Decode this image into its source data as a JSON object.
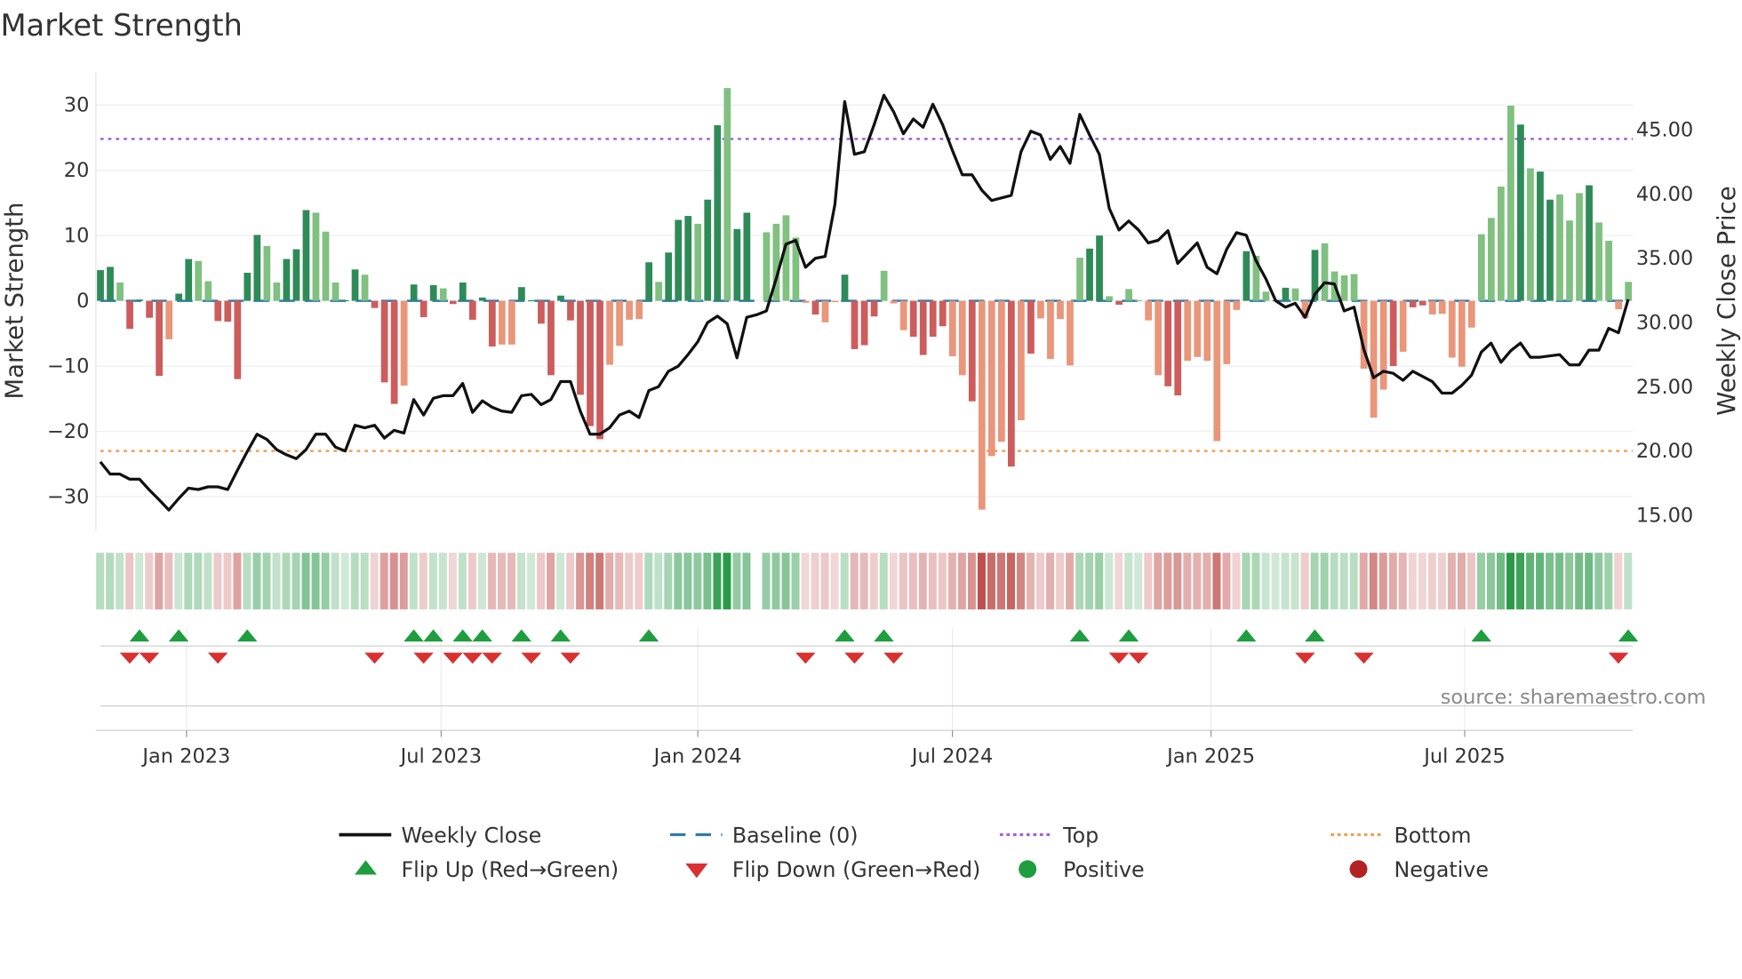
{
  "chart_data": {
    "type": "bar",
    "title": "Market Strength",
    "ylabel": "Market Strength",
    "y2label": "Weekly Close Price",
    "ylim": [
      -33,
      33
    ],
    "y2lim": [
      13.2,
      50.3
    ],
    "yticks": [
      30,
      20,
      10,
      0,
      -10,
      -20,
      -30
    ],
    "yticklabels": [
      "30",
      "20",
      "10",
      "0",
      "−10",
      "−20",
      "−30"
    ],
    "y2ticks": [
      45,
      40,
      35,
      30,
      25,
      20,
      15
    ],
    "y2ticklabels": [
      "45.00",
      "40.00",
      "35.00",
      "30.00",
      "25.00",
      "20.00",
      "15.00"
    ],
    "x_unit": "week index",
    "xticks": [
      {
        "label": "Jan 2023",
        "week": 8.8
      },
      {
        "label": "Jul 2023",
        "week": 34.8
      },
      {
        "label": "Jan 2024",
        "week": 61
      },
      {
        "label": "Jul 2024",
        "week": 87
      },
      {
        "label": "Jan 2025",
        "week": 113.4
      },
      {
        "label": "Jul 2025",
        "week": 139.3
      }
    ],
    "top_level": 24.8,
    "bottom_level": -23,
    "baseline": 0,
    "strength": [
      4.7,
      5.2,
      2.8,
      -4.3,
      0.2,
      -2.6,
      -11.5,
      -5.9,
      1.1,
      6.4,
      6.1,
      3.0,
      -3.1,
      -3.2,
      -12,
      4.3,
      10.1,
      8.4,
      2.8,
      6.4,
      7.9,
      13.9,
      13.5,
      10.6,
      2.8,
      0.1,
      4.8,
      4.0,
      -1.1,
      -12.5,
      -15.8,
      -13,
      2.5,
      -2.5,
      2.4,
      1.9,
      -0.5,
      2.8,
      -2.9,
      0.5,
      -7,
      -6.7,
      -6.7,
      2.1,
      0.1,
      -3.5,
      -11.4,
      0.8,
      -3,
      -14.4,
      -19.2,
      -21.2,
      -9.8,
      -6.9,
      -2.9,
      -2.8,
      5.9,
      2.9,
      7.4,
      12.4,
      13.0,
      11.8,
      15.5,
      26.9,
      32.6,
      11.0,
      13.5,
      0,
      10.5,
      11.8,
      13.1,
      9.7,
      -0.3,
      -2.1,
      -3.3,
      -0.2,
      4.0,
      -7.4,
      -6.8,
      -2.4,
      4.6,
      -0.4,
      -4.5,
      -5.5,
      -8.3,
      -5.5,
      -3.9,
      -8.5,
      -11.4,
      -15.4,
      -32,
      -23.8,
      -21.6,
      -25.4,
      -18.3,
      -8.1,
      -2.7,
      -8.9,
      -2.8,
      -9.9,
      6.6,
      8.0,
      10.0,
      0.7,
      -0.6,
      1.8,
      0.1,
      -3.0,
      -11.4,
      -13.1,
      -14.5,
      -9.2,
      -8.6,
      -9.2,
      -21.5,
      -9.7,
      -1.4,
      7.6,
      6.9,
      1.4,
      0.1,
      2.0,
      1.9,
      -2.7,
      7.8,
      8.8,
      4.5,
      3.9,
      4.1,
      -10.4,
      -17.9,
      -13.6,
      -10,
      -7.8,
      -1,
      -0.7,
      -2.1,
      -2.0,
      -8.7,
      -10.1,
      -4.1,
      10.2,
      12.7,
      17.5,
      29.9,
      27,
      20.3,
      19.8,
      15.5,
      16.3,
      12.3,
      16.5,
      17.7,
      12,
      9.2,
      -1.3,
      2.9
    ],
    "strength_tone": "GGgRGRRrGGggRRRGGggGGGgggGGgRRRrGRGgRGRGRrrGGRRGRRRRrrrrGgGGGgGGgGGgRRRRGRrrGRRRRrrRRRRrrRrrrRrRGGGgRGGRRRRrrRRrrGggGGgRGGggGRRrrrrrRrRRrGGGGggggGgGGggRG",
    "weekly_close": [
      19.15,
      18.2,
      18.2,
      17.8,
      17.8,
      16.96,
      16.2,
      15.4,
      16.3,
      17.1,
      17.0,
      17.2,
      17.2,
      17.0,
      18.5,
      19.95,
      21.3,
      20.9,
      20.1,
      19.7,
      19.4,
      20.1,
      21.3,
      21.3,
      20.3,
      20.0,
      22.0,
      21.8,
      22.0,
      21.0,
      21.6,
      21.4,
      24.0,
      22.8,
      24.1,
      24.3,
      24.3,
      25.25,
      23.0,
      23.9,
      23.4,
      23.1,
      23.0,
      24.3,
      24.4,
      23.6,
      24.0,
      25.4,
      25.4,
      23.1,
      21.3,
      21.3,
      21.8,
      22.8,
      23.1,
      22.6,
      24.7,
      25.0,
      26.2,
      26.6,
      27.5,
      28.5,
      30.0,
      30.5,
      29.9,
      27.25,
      30.4,
      30.6,
      30.9,
      33.4,
      36.1,
      36.4,
      34.3,
      35.0,
      35.15,
      39.2,
      47.2,
      43.1,
      43.3,
      45.4,
      47.7,
      46.4,
      44.7,
      45.85,
      45.2,
      47.0,
      45.4,
      43.4,
      41.5,
      41.5,
      40.3,
      39.5,
      39.7,
      39.9,
      43.3,
      44.9,
      44.6,
      42.7,
      43.7,
      42.4,
      46.2,
      44.6,
      43.1,
      38.9,
      37.2,
      37.9,
      37.2,
      36.2,
      36.4,
      37.15,
      34.6,
      35.4,
      36.2,
      34.3,
      33.8,
      35.7,
      37.0,
      36.8,
      34.8,
      33.4,
      31.7,
      31.2,
      31.5,
      30.4,
      32.2,
      33.1,
      33.0,
      30.9,
      31.2,
      27.9,
      25.7,
      26.2,
      26.05,
      25.5,
      26.2,
      25.8,
      25.4,
      24.5,
      24.5,
      25.1,
      25.9,
      27.7,
      28.4,
      26.9,
      27.8,
      28.4,
      27.3,
      27.3,
      27.4,
      27.5,
      26.7,
      26.7,
      27.85,
      27.85,
      29.55,
      29.2,
      31.8
    ],
    "flip_up_weeks": [
      4,
      8,
      15,
      32,
      34,
      37,
      39,
      43,
      47,
      56,
      76,
      80,
      100,
      105,
      117,
      124,
      141,
      156
    ],
    "flip_down_weeks": [
      3,
      5,
      12,
      28,
      33,
      36,
      38,
      40,
      44,
      48,
      72,
      77,
      81,
      104,
      106,
      123,
      129,
      155
    ],
    "legend_placement": "bottom",
    "legend": [
      {
        "label": "Weekly Close",
        "icon": "line-solid",
        "color": "#111111"
      },
      {
        "label": "Baseline (0)",
        "icon": "line-dashed",
        "color": "#2b7bb0"
      },
      {
        "label": "Top",
        "icon": "line-dotted",
        "color": "#a060e0"
      },
      {
        "label": "Bottom",
        "icon": "line-dotted",
        "color": "#f0a050"
      },
      {
        "label": "Flip Up (Red→Green)",
        "icon": "triangle-up",
        "color": "#1e9e3e"
      },
      {
        "label": "Flip Down (Green→Red)",
        "icon": "triangle-down",
        "color": "#d93030"
      },
      {
        "label": "Positive",
        "icon": "circle",
        "color": "#1e9e3e"
      },
      {
        "label": "Negative",
        "icon": "circle",
        "color": "#b22222"
      }
    ],
    "colors": {
      "strong_pos": "#2e8b57",
      "weak_pos": "#80c080",
      "strong_neg": "#cd5c5c",
      "weak_neg": "#e9967a"
    }
  },
  "source": "source: sharemaestro.com"
}
